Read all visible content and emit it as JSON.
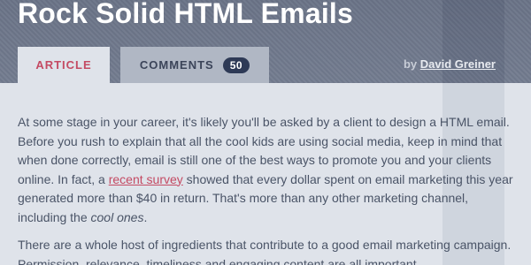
{
  "header": {
    "title": "Rock Solid HTML Emails",
    "byline_prefix": "by ",
    "author": "David Greiner"
  },
  "tabs": [
    {
      "label": "ARTICLE",
      "active": true
    },
    {
      "label": "COMMENTS",
      "count": "50",
      "active": false
    }
  ],
  "article": {
    "para1": {
      "text_before_link": "At some stage in your career, it's likely you'll be asked by a client to design a HTML email. Before you rush to explain that all the cool kids are using social media, keep in mind that when done correctly, email is still one of the best ways to promote you and your clients online. In fact, a ",
      "link_text": "recent survey",
      "text_after_link": " showed that every dollar spent on email marketing this year generated more than $40 in return. That's more than any other marketing channel, including the ",
      "emphasis": "cool ones",
      "text_end": "."
    },
    "para2": {
      "text": "There are a whole host of ingredients that contribute to a good email marketing campaign. Permission, relevance, timeliness and engaging content are all important"
    }
  },
  "colors": {
    "accent": "#c44a63",
    "header_bg": "#6f788b",
    "content_bg": "#dfe3ea",
    "badge_bg": "#2e3a56"
  }
}
